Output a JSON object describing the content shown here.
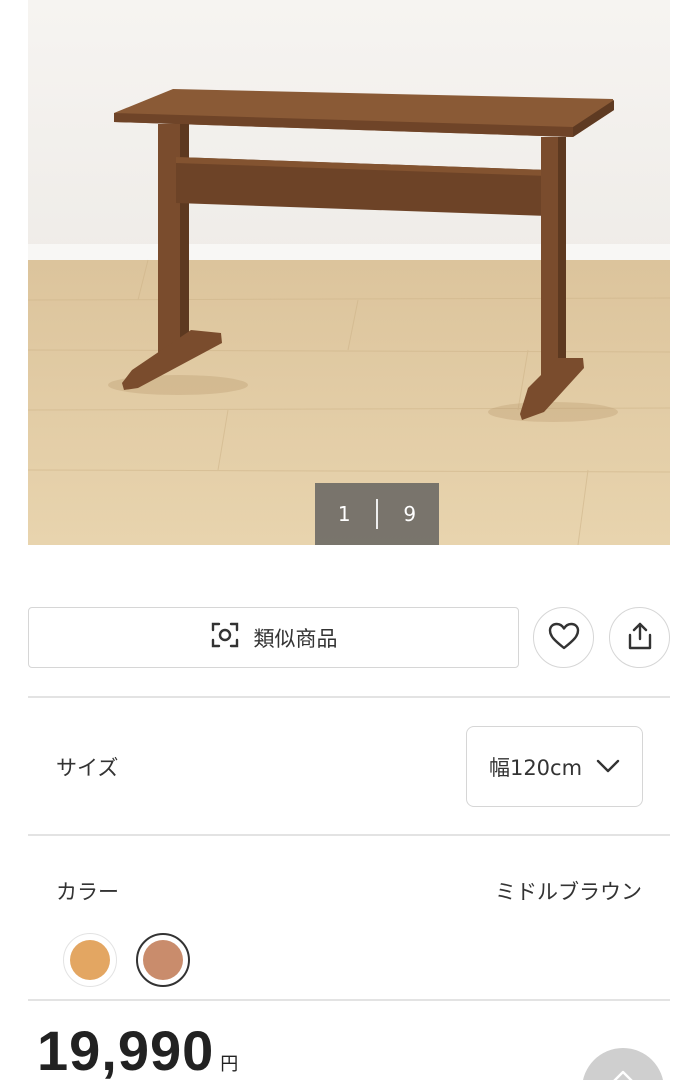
{
  "gallery": {
    "current_page": "1",
    "total_pages": "9"
  },
  "actions": {
    "similar_label": "類似商品",
    "similar_icon": "visual-search-icon",
    "favorite_icon": "heart-icon",
    "share_icon": "share-icon"
  },
  "size": {
    "label": "サイズ",
    "selected": "幅120cm",
    "icon": "chevron-down-icon"
  },
  "color": {
    "label": "カラー",
    "selected_name": "ミドルブラウン",
    "swatches": [
      {
        "hex": "#e3a662",
        "selected": false
      },
      {
        "hex": "#c98c6c",
        "selected": true
      }
    ]
  },
  "price": {
    "value": "19,990",
    "unit": "円"
  }
}
